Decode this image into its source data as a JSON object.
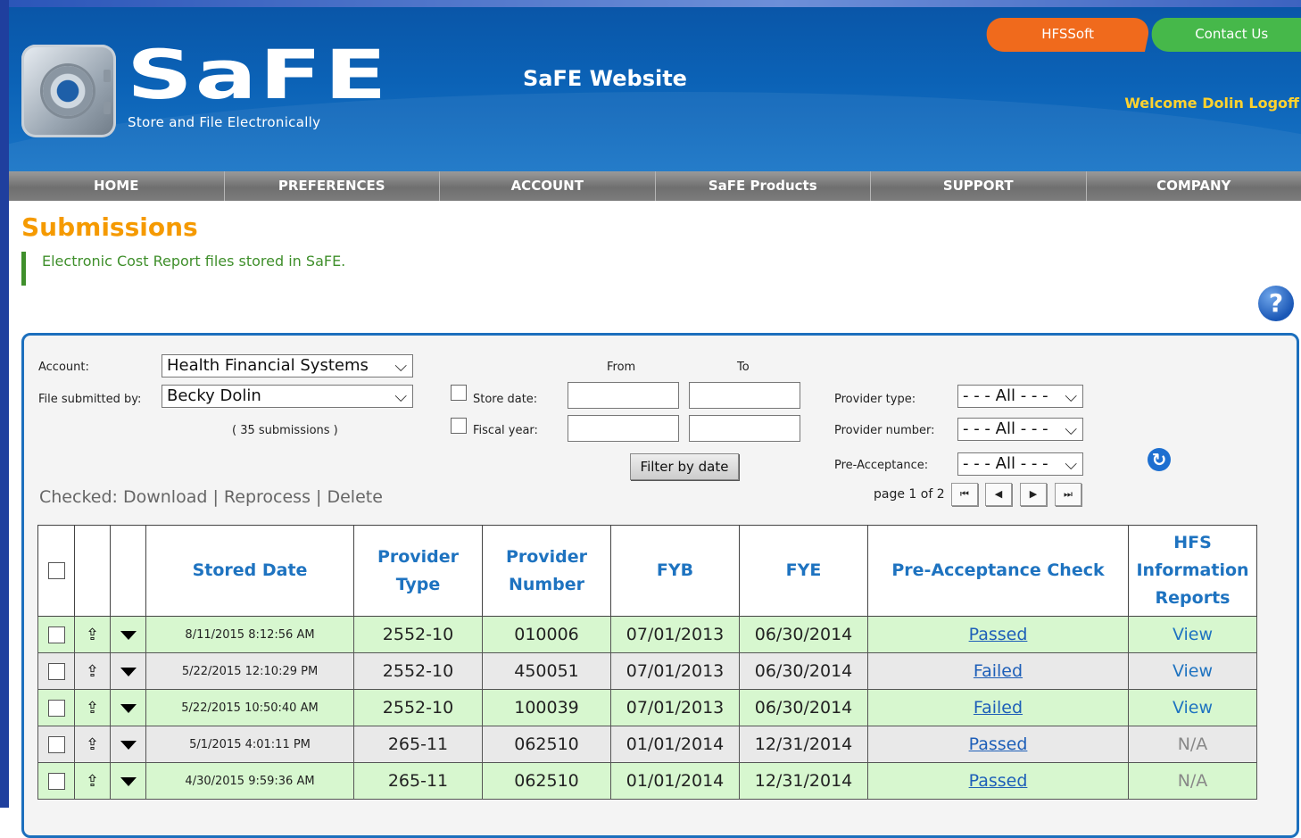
{
  "header": {
    "logo_word": "SaFE",
    "logo_tagline": "Store and File Electronically",
    "site_title": "SaFE Website",
    "tab_hfssoft": "HFSSoft",
    "tab_contact": "Contact Us",
    "welcome": "Welcome Dolin Logoff"
  },
  "nav": [
    "HOME",
    "PREFERENCES",
    "ACCOUNT",
    "SaFE Products",
    "SUPPORT",
    "COMPANY"
  ],
  "page": {
    "title": "Submissions",
    "subtitle": "Electronic Cost Report files stored in SaFE.",
    "help_glyph": "?"
  },
  "filters": {
    "account_label": "Account:",
    "account_value": "Health Financial Systems",
    "submitted_by_label": "File submitted by:",
    "submitted_by_value": "Becky Dolin",
    "count_text": "( 35 submissions )",
    "from_label": "From",
    "to_label": "To",
    "store_date_label": "Store date:",
    "fiscal_year_label": "Fiscal year:",
    "filter_button": "Filter by date",
    "provider_type_label": "Provider type:",
    "provider_type_value": "- - - All - - -",
    "provider_number_label": "Provider number:",
    "provider_number_value": "- - - All - - -",
    "preacceptance_label": "Pre-Acceptance:",
    "preacceptance_value": "- - - All - - -"
  },
  "actions": {
    "checked": "Checked:",
    "download": "Download",
    "reprocess": "Reprocess",
    "delete": "Delete",
    "sep": "|"
  },
  "pager": {
    "text": "page 1 of 2",
    "first": "⏮",
    "prev": "◀",
    "next": "▶",
    "last": "⏭"
  },
  "table": {
    "headers": {
      "stored_date": "Stored Date",
      "provider_type_1": "Provider",
      "provider_type_2": "Type",
      "provider_number_1": "Provider",
      "provider_number_2": "Number",
      "fyb": "FYB",
      "fye": "FYE",
      "preacceptance": "Pre-Acceptance Check",
      "hfs_1": "HFS",
      "hfs_2": "Information",
      "hfs_3": "Reports"
    },
    "rows": [
      {
        "date": "8/11/2015 8:12:56 AM",
        "type": "2552-10",
        "number": "010006",
        "fyb": "07/01/2013",
        "fye": "06/30/2014",
        "check": "Passed",
        "report": "View"
      },
      {
        "date": "5/22/2015 12:10:29 PM",
        "type": "2552-10",
        "number": "450051",
        "fyb": "07/01/2013",
        "fye": "06/30/2014",
        "check": "Failed",
        "report": "View"
      },
      {
        "date": "5/22/2015 10:50:40 AM",
        "type": "2552-10",
        "number": "100039",
        "fyb": "07/01/2013",
        "fye": "06/30/2014",
        "check": "Failed",
        "report": "View"
      },
      {
        "date": "5/1/2015 4:01:11 PM",
        "type": "265-11",
        "number": "062510",
        "fyb": "01/01/2014",
        "fye": "12/31/2014",
        "check": "Passed",
        "report": "N/A"
      },
      {
        "date": "4/30/2015 9:59:36 AM",
        "type": "265-11",
        "number": "062510",
        "fyb": "01/01/2014",
        "fye": "12/31/2014",
        "check": "Passed",
        "report": "N/A"
      }
    ]
  },
  "colors": {
    "header_blue": "#0b62b6",
    "title_orange": "#f59a00",
    "subtitle_green": "#3f8f2b",
    "row_green": "#d7f7cf",
    "row_gray": "#e9e9e9",
    "link_blue": "#1e73c0"
  },
  "icons": {
    "upload": "upload-icon",
    "dropdown": "caret-down-icon",
    "refresh": "refresh-icon",
    "help": "help-icon"
  }
}
